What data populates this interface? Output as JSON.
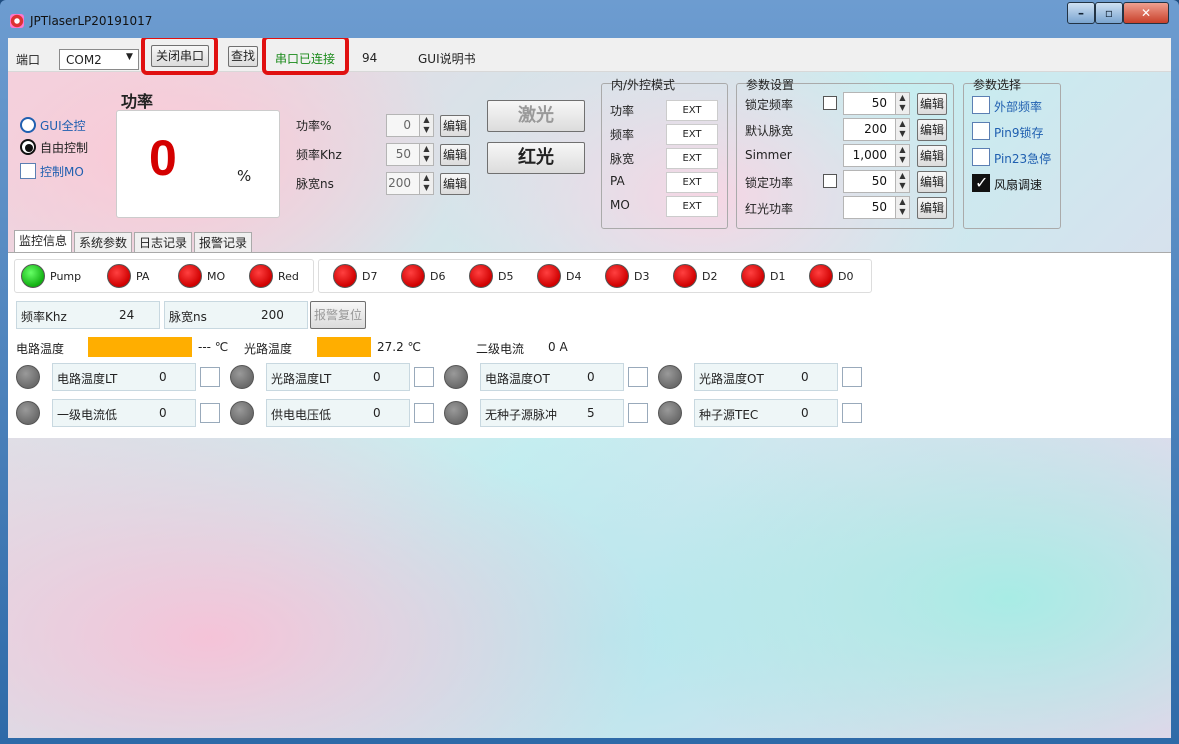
{
  "window": {
    "title": "JPTlaserLP20191017"
  },
  "topbar": {
    "port_label": "端口",
    "port_value": "COM2",
    "close_port_label": "关闭串口",
    "find_label": "查找",
    "status_label": "串口已连接",
    "status_color": "#1a8a1a",
    "count_value": "94",
    "gui_manual_label": "GUI说明书"
  },
  "control_mode": {
    "options": [
      "GUI全控",
      "自由控制"
    ],
    "selected": "自由控制",
    "mo_label": "控制MO"
  },
  "power_display": {
    "title": "功率",
    "value": "0",
    "unit": "%",
    "value_color": "#d40000"
  },
  "power_params": [
    {
      "label": "功率%",
      "value": "0",
      "edit_label": "编辑"
    },
    {
      "label": "频率Khz",
      "value": "50",
      "edit_label": "编辑"
    },
    {
      "label": "脉宽ns",
      "value": "200",
      "edit_label": "编辑"
    }
  ],
  "laser_buttons": {
    "laser_label": "激光",
    "red_label": "红光"
  },
  "inner_outer": {
    "title": "内/外控模式",
    "rows": [
      {
        "label": "功率",
        "value": "EXT"
      },
      {
        "label": "频率",
        "value": "EXT"
      },
      {
        "label": "脉宽",
        "value": "EXT"
      },
      {
        "label": "PA",
        "value": "EXT"
      },
      {
        "label": "MO",
        "value": "EXT"
      }
    ]
  },
  "param_settings": {
    "title": "参数设置",
    "edit_label": "编辑",
    "rows": [
      {
        "label": "锁定频率",
        "has_checkbox": true,
        "value": "50"
      },
      {
        "label": "默认脉宽",
        "has_checkbox": false,
        "value": "200"
      },
      {
        "label": "Simmer",
        "has_checkbox": false,
        "value": "1,000"
      },
      {
        "label": "锁定功率",
        "has_checkbox": true,
        "value": "50"
      },
      {
        "label": "红光功率",
        "has_checkbox": false,
        "value": "50"
      }
    ]
  },
  "param_select": {
    "title": "参数选择",
    "items": [
      {
        "label": "外部频率",
        "checked": false
      },
      {
        "label": "Pin9锁存",
        "checked": false
      },
      {
        "label": "Pin23急停",
        "checked": false
      },
      {
        "label": "风扇调速",
        "checked": true
      }
    ],
    "label_color": "#1f5fb0"
  },
  "tabs": [
    "监控信息",
    "系统参数",
    "日志记录",
    "报警记录"
  ],
  "leds": [
    {
      "label": "Pump",
      "state": "green"
    },
    {
      "label": "PA",
      "state": "red"
    },
    {
      "label": "MO",
      "state": "red"
    },
    {
      "label": "Red",
      "state": "red"
    }
  ],
  "digital_leds": [
    {
      "label": "D7",
      "state": "red"
    },
    {
      "label": "D6",
      "state": "red"
    },
    {
      "label": "D5",
      "state": "red"
    },
    {
      "label": "D4",
      "state": "red"
    },
    {
      "label": "D3",
      "state": "red"
    },
    {
      "label": "D2",
      "state": "red"
    },
    {
      "label": "D1",
      "state": "red"
    },
    {
      "label": "D0",
      "state": "red"
    }
  ],
  "freq_row": {
    "freq_label": "频率Khz",
    "freq_value": "24",
    "pulse_label": "脉宽ns",
    "pulse_value": "200",
    "reset_label": "报警复位"
  },
  "temps": {
    "circuit_label": "电路温度",
    "circuit_value": "--- ℃",
    "optical_label": "光路温度",
    "optical_value": "27.2 ℃",
    "current_label": "二级电流",
    "current_value": "0 A",
    "bar_color": "#ffae00"
  },
  "alarms": [
    {
      "label": "电路温度LT",
      "value": "0"
    },
    {
      "label": "光路温度LT",
      "value": "0"
    },
    {
      "label": "电路温度OT",
      "value": "0"
    },
    {
      "label": "光路温度OT",
      "value": "0"
    },
    {
      "label": "一级电流低",
      "value": "0"
    },
    {
      "label": "供电电压低",
      "value": "0"
    },
    {
      "label": "无种子源脉冲",
      "value": "5"
    },
    {
      "label": "种子源TEC",
      "value": "0"
    }
  ]
}
